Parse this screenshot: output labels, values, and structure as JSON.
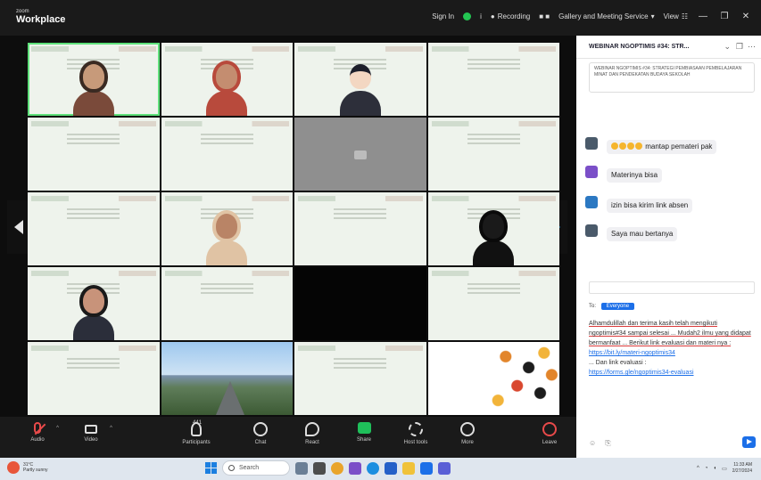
{
  "app": {
    "brand_small": "zoom",
    "brand_big": "Workplace"
  },
  "titlebar": {
    "sign_in": "Sign In",
    "recording": "Recording",
    "view_name": "Gallery and Meeting Service",
    "view_label": "View"
  },
  "tiles": [
    {
      "name": "",
      "kind": "person",
      "skin": "#c79a7a",
      "clothes": "#7a4a3a",
      "hair": "#3a2a22",
      "active": true
    },
    {
      "name": "",
      "kind": "person",
      "skin": "#c48d70",
      "clothes": "#b84a3c",
      "hair": "#b84a3c"
    },
    {
      "name": "",
      "kind": "avatar"
    },
    {
      "name": "",
      "kind": "slide"
    },
    {
      "name": "",
      "kind": "slide"
    },
    {
      "name": "",
      "kind": "slide"
    },
    {
      "name": "",
      "kind": "gray"
    },
    {
      "name": "",
      "kind": "slide"
    },
    {
      "name": "",
      "kind": "slide"
    },
    {
      "name": "",
      "kind": "person",
      "skin": "#b98466",
      "clothes": "#e0c3a4",
      "hair": "#e0c3a4"
    },
    {
      "name": "",
      "kind": "slide"
    },
    {
      "name": "",
      "kind": "person",
      "skin": "#1a1a1a",
      "clothes": "#111",
      "hair": "#0a0a0a"
    },
    {
      "name": "",
      "kind": "person",
      "skin": "#c8937a",
      "clothes": "#2b2e3a",
      "hair": "#1a1a1a"
    },
    {
      "name": "",
      "kind": "slide"
    },
    {
      "name": "",
      "kind": "black"
    },
    {
      "name": "",
      "kind": "slide"
    },
    {
      "name": "",
      "kind": "slide"
    },
    {
      "name": "",
      "kind": "landscape"
    },
    {
      "name": "",
      "kind": "slide"
    },
    {
      "name": "",
      "kind": "poster"
    }
  ],
  "toolbar": {
    "audio": "Audio",
    "video": "Video",
    "participants": "Participants",
    "participants_count": "441",
    "chat": "Chat",
    "react": "React",
    "share": "Share",
    "host_tools": "Host tools",
    "more": "More",
    "leave": "Leave"
  },
  "chat": {
    "title": "WEBINAR NGOPTIMIS #34: STR...",
    "pinned": "WEBINAR NGOPTIMIS #34: STRATEGI PEMBIASAAN PEMBELAJARAN MINAT DAN PENDEKATAN BUDAYA SEKOLAH",
    "messages": [
      {
        "sender": "",
        "to": "",
        "time": "",
        "text": "mantap pemateri pak",
        "avatar": "#4a5a6a",
        "emoji": true
      },
      {
        "sender": "",
        "to": "",
        "time": "",
        "text": "Materinya bisa",
        "avatar": "#7b4fc8",
        "emoji": false
      },
      {
        "sender": "",
        "to": "",
        "time": "",
        "text": "izin bisa kirim link absen",
        "avatar": "#2b78c2",
        "emoji": false
      },
      {
        "sender": "",
        "to": "",
        "time": "",
        "text": "Saya mau bertanya",
        "avatar": "#4a5a6a",
        "emoji": false
      }
    ],
    "reply_hint": "",
    "to_label": "To:",
    "to_target": "Everyone",
    "compose_text": "Alhamdulillah dan terima kasih telah mengikuti ngoptimis#34 sampai selesai ... Mudah2 ilmu yang didapat bermanfaat ... Berikut link evaluasi dan materi nya :",
    "link1": "https://bit.ly/materi-ngoptimis34",
    "link2_label": "... Dan link evaluasi :",
    "link2": "https://forms.gle/ngoptimis34-evaluasi"
  },
  "taskbar": {
    "weather_temp": "31°C",
    "weather_desc": "Partly sunny",
    "search": "Search",
    "time": "11:33 AM",
    "date": "2/27/2024"
  },
  "colors": {
    "accent": "#1c6fe8",
    "share": "#1fbf5a",
    "danger": "#e84a4a",
    "active_tile": "#5ee07a"
  }
}
